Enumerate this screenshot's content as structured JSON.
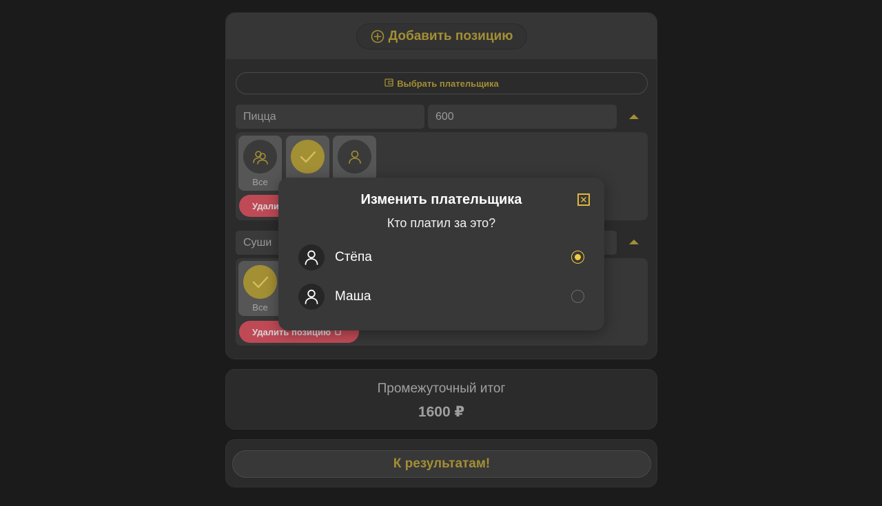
{
  "header": {
    "add_position_label": "Добавить позицию"
  },
  "payer_button_label": "Выбрать плательщика",
  "items": [
    {
      "name": "Пицца",
      "price": "600",
      "chips": [
        {
          "label": "Все"
        }
      ],
      "delete_label": "Удалить позицию"
    },
    {
      "name": "Суши",
      "price": "",
      "chips": [
        {
          "label": "Все"
        }
      ],
      "delete_label": "Удалить позицию"
    }
  ],
  "subtotal": {
    "label": "Промежуточный итог",
    "value": "1600 ₽"
  },
  "results_button_label": "К результатам!",
  "modal": {
    "title": "Изменить плательщика",
    "question": "Кто платил за это?",
    "options": [
      {
        "name": "Стёпа",
        "selected": true
      },
      {
        "name": "Маша",
        "selected": false
      }
    ]
  },
  "colors": {
    "accent": "#a38f34",
    "danger": "#bf4a56",
    "background": "#1b1b1b",
    "panel": "#2b2b2b",
    "radio_selected": "#f2cb41"
  }
}
